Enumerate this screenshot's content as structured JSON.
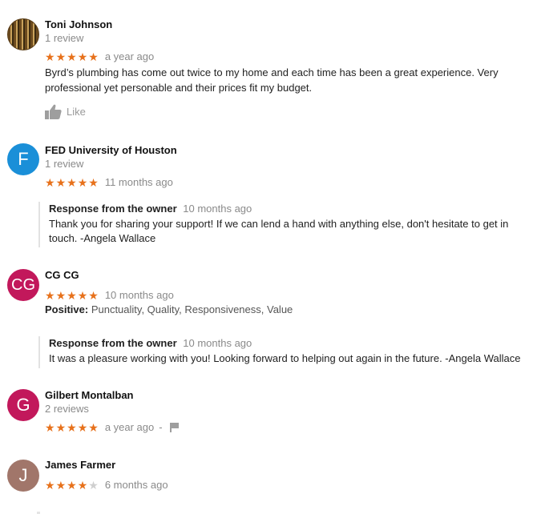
{
  "reviews": [
    {
      "name": "Toni Johnson",
      "count": "1 review",
      "avatar": {
        "type": "photo"
      },
      "stars": 5,
      "ago": "a year ago",
      "text": "Byrd’s plumbing has come out twice to my home and each time has been a great experience. Very professional yet personable and their prices fit my budget.",
      "like_label": "Like"
    },
    {
      "name": "FED University of Houston",
      "count": "1 review",
      "avatar": {
        "type": "letter",
        "letter": "F",
        "color": "#1a8fd8"
      },
      "stars": 5,
      "ago": "11 months ago",
      "response": {
        "title": "Response from the owner",
        "ago": "10 months ago",
        "text": "Thank you for sharing your support! If we can lend a hand with anything else, don't hesitate to get in touch. -Angela Wallace"
      }
    },
    {
      "name": "CG CG",
      "avatar": {
        "type": "letter",
        "letter": "CG",
        "color": "#c2185b"
      },
      "stars": 5,
      "ago": "10 months ago",
      "positive_label": "Positive:",
      "positive_text": "Punctuality, Quality, Responsiveness, Value",
      "response": {
        "title": "Response from the owner",
        "ago": "10 months ago",
        "text": "It was a pleasure working with you! Looking forward to helping out again in the future. -Angela Wallace"
      }
    },
    {
      "name": "Gilbert Montalban",
      "count": "2 reviews",
      "avatar": {
        "type": "letter",
        "letter": "G",
        "color": "#c2185b"
      },
      "stars": 5,
      "ago": "a year ago",
      "separator": "-"
    },
    {
      "name": "James Farmer",
      "avatar": {
        "type": "letter",
        "letter": "J",
        "color": "#a1766a"
      },
      "stars": 4,
      "ago": "6 months ago"
    }
  ],
  "icons": {
    "star": "★",
    "like": "thumbs-up-icon",
    "flag": "flag-icon"
  },
  "colors": {
    "star_on": "#e7711b",
    "star_off": "#cfcfcf"
  }
}
